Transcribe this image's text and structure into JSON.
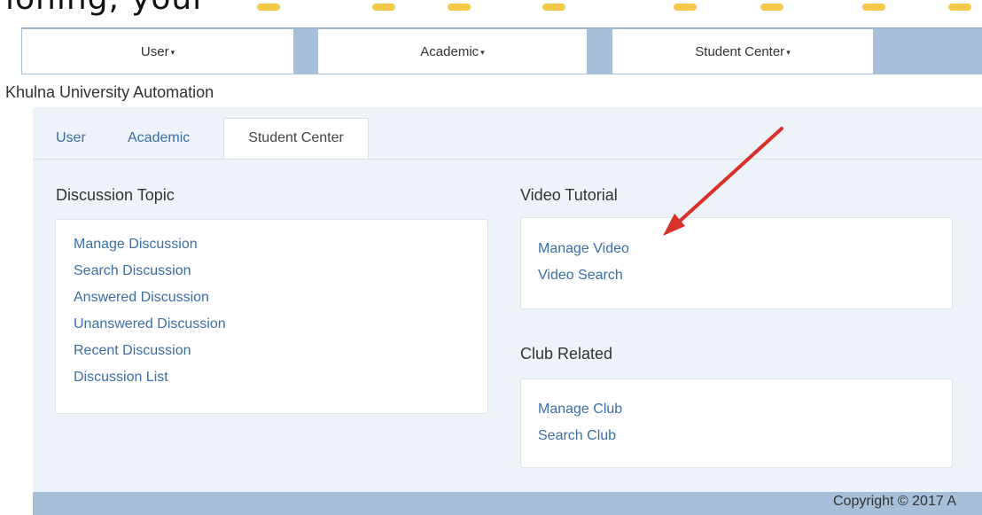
{
  "top_residue": {
    "text": "ioning; your",
    "dot_color": "#f3c94a"
  },
  "navbar": {
    "items": [
      {
        "label": "User"
      },
      {
        "label": "Academic"
      },
      {
        "label": "Student Center"
      }
    ],
    "caret": "▾"
  },
  "brand": "Khulna University Automation",
  "tabs": [
    {
      "label": "User",
      "active": false
    },
    {
      "label": "Academic",
      "active": false
    },
    {
      "label": "Student Center",
      "active": true
    }
  ],
  "sections": {
    "discussion": {
      "title": "Discussion Topic",
      "links": [
        "Manage Discussion",
        "Search Discussion",
        "Answered Discussion",
        "Unanswered Discussion",
        "Recent Discussion",
        "Discussion List"
      ]
    },
    "video": {
      "title": "Video Tutorial",
      "links": [
        "Manage Video",
        "Video Search"
      ]
    },
    "club": {
      "title": "Club Related",
      "links": [
        "Manage Club",
        "Search Club"
      ]
    }
  },
  "footer": {
    "copyright": "Copyright © 2017 A"
  },
  "colors": {
    "nav_bg": "#a7bfd8",
    "panel_bg": "#eef3f9",
    "link": "#3a6ea5",
    "arrow": "#d9302c"
  }
}
